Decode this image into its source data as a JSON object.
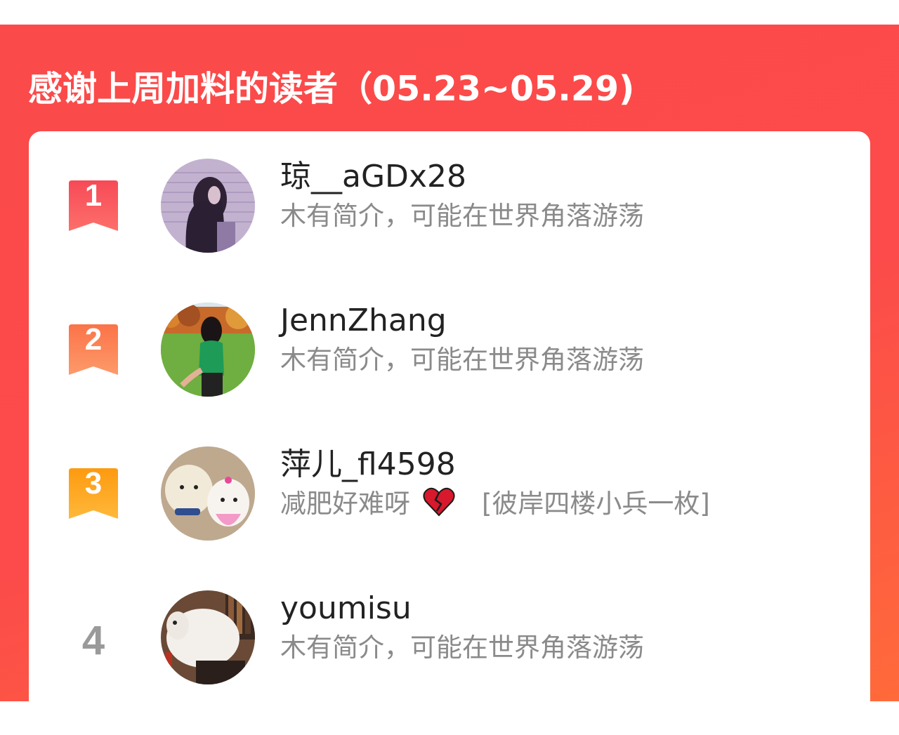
{
  "header": {
    "title": "感谢上周加料的读者（05.23~05.29)"
  },
  "colors": {
    "banner": "#fb4a4a",
    "banner_end": "#ff6a3a",
    "rank1": "#fb5a5e",
    "rank2": "#fd7f4e",
    "rank3": "#fda41c",
    "rank_other": "#9a9a9a"
  },
  "readers": [
    {
      "rank": "1",
      "name": "琼__aGDx28",
      "bio": "木有简介，可能在世界角落游荡",
      "avatar": "avatar-girl-purple"
    },
    {
      "rank": "2",
      "name": "JennZhang",
      "bio": "木有简介，可能在世界角落游荡",
      "avatar": "avatar-girl-green-field"
    },
    {
      "rank": "3",
      "name": "萍儿_fl4598",
      "bio_before": "减肥好难呀",
      "bio_emoji": "broken-heart-icon",
      "bio_after": "[彼岸四楼小兵一枚]",
      "avatar": "avatar-dogs"
    },
    {
      "rank": "4",
      "name": "youmisu",
      "bio": "木有简介，可能在世界角落游荡",
      "avatar": "avatar-white-dog"
    }
  ]
}
